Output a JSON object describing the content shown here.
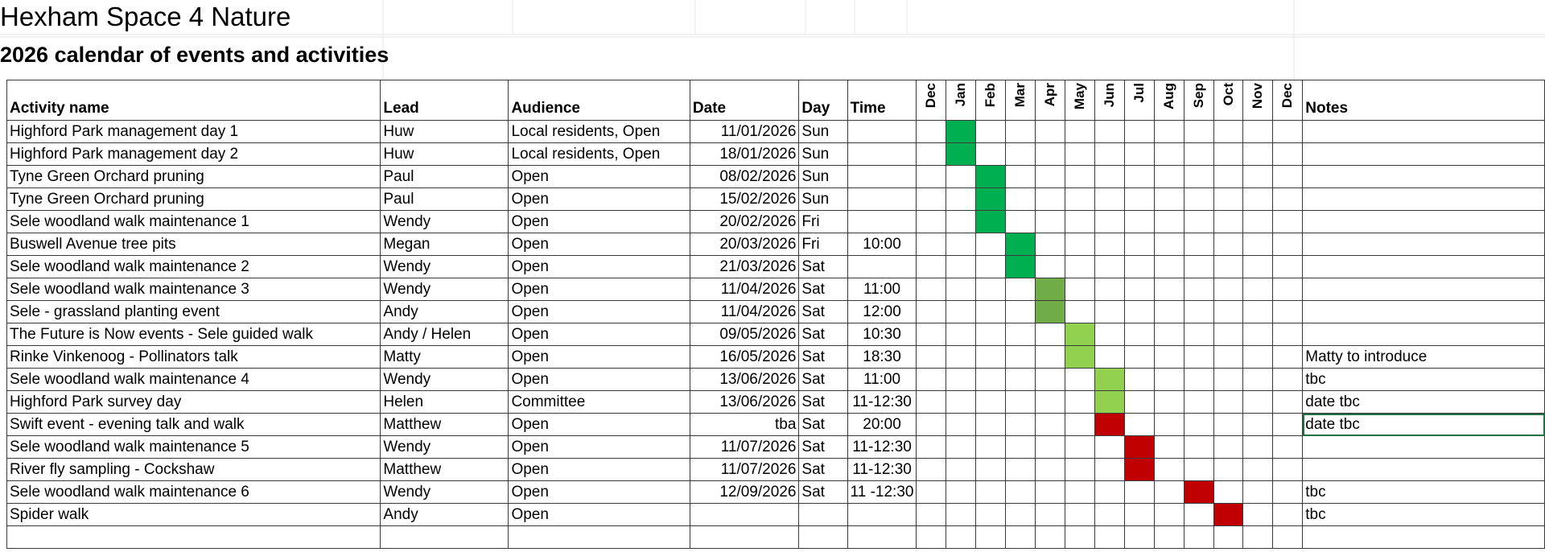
{
  "title": "Hexham Space 4 Nature",
  "subtitle": "2026 calendar of events and activities",
  "headers": {
    "activity": "Activity name",
    "lead": "Lead",
    "audience": "Audience",
    "date": "Date",
    "day": "Day",
    "time": "Time",
    "notes": "Notes",
    "months": [
      "Dec",
      "Jan",
      "Feb",
      "Mar",
      "Apr",
      "May",
      "Jun",
      "Jul",
      "Aug",
      "Sep",
      "Oct",
      "Nov",
      "Dec"
    ]
  },
  "colors": {
    "green_bright": "#00b050",
    "green_olive": "#70ad47",
    "green_light": "#92d050",
    "red": "#c00000"
  },
  "rows": [
    {
      "activity": "Highford Park management day 1",
      "lead": "Huw",
      "audience": "Local residents, Open",
      "date": "11/01/2026",
      "day": "Sun",
      "time": "",
      "notes": "",
      "month": 1,
      "color": "green_bright"
    },
    {
      "activity": "Highford Park management day 2",
      "lead": "Huw",
      "audience": "Local residents, Open",
      "date": "18/01/2026",
      "day": "Sun",
      "time": "",
      "notes": "",
      "month": 1,
      "color": "green_bright"
    },
    {
      "activity": "Tyne Green Orchard pruning",
      "lead": "Paul",
      "audience": "Open",
      "date": "08/02/2026",
      "day": "Sun",
      "time": "",
      "notes": "",
      "month": 2,
      "color": "green_bright"
    },
    {
      "activity": "Tyne Green Orchard pruning",
      "lead": "Paul",
      "audience": "Open",
      "date": "15/02/2026",
      "day": "Sun",
      "time": "",
      "notes": "",
      "month": 2,
      "color": "green_bright"
    },
    {
      "activity": "Sele woodland walk maintenance 1",
      "lead": "Wendy",
      "audience": "Open",
      "date": "20/02/2026",
      "day": "Fri",
      "time": "",
      "notes": "",
      "month": 2,
      "color": "green_bright"
    },
    {
      "activity": "Buswell Avenue tree pits",
      "lead": "Megan",
      "audience": "Open",
      "date": "20/03/2026",
      "day": "Fri",
      "time": "10:00",
      "notes": "",
      "month": 3,
      "color": "green_bright"
    },
    {
      "activity": "Sele woodland walk maintenance 2",
      "lead": "Wendy",
      "audience": "Open",
      "date": "21/03/2026",
      "day": "Sat",
      "time": "",
      "notes": "",
      "month": 3,
      "color": "green_bright"
    },
    {
      "activity": "Sele woodland walk maintenance 3",
      "lead": "Wendy",
      "audience": "Open",
      "date": "11/04/2026",
      "day": "Sat",
      "time": "11:00",
      "notes": "",
      "month": 4,
      "color": "green_olive"
    },
    {
      "activity": "Sele - grassland planting event",
      "lead": "Andy",
      "audience": "Open",
      "date": "11/04/2026",
      "day": "Sat",
      "time": "12:00",
      "notes": "",
      "month": 4,
      "color": "green_olive"
    },
    {
      "activity": "The Future is Now events - Sele guided walk",
      "lead": "Andy / Helen",
      "audience": "Open",
      "date": "09/05/2026",
      "day": "Sat",
      "time": "10:30",
      "notes": "",
      "month": 5,
      "color": "green_light"
    },
    {
      "activity": "Rinke Vinkenoog - Pollinators talk",
      "lead": "Matty",
      "audience": "Open",
      "date": "16/05/2026",
      "day": "Sat",
      "time": "18:30",
      "notes": "Matty to introduce",
      "month": 5,
      "color": "green_light"
    },
    {
      "activity": "Sele woodland walk maintenance 4",
      "lead": "Wendy",
      "audience": "Open",
      "date": "13/06/2026",
      "day": "Sat",
      "time": "11:00",
      "notes": "tbc",
      "month": 6,
      "color": "green_light"
    },
    {
      "activity": "Highford Park survey day",
      "lead": "Helen",
      "audience": "Committee",
      "date": "13/06/2026",
      "day": "Sat",
      "time": "11-12:30",
      "notes": "date tbc",
      "month": 6,
      "color": "green_light"
    },
    {
      "activity": "Swift event - evening talk and walk",
      "lead": "Matthew",
      "audience": "Open",
      "date": "tba",
      "day": "Sat",
      "time": "20:00",
      "notes": "date tbc",
      "month": 6,
      "color": "red"
    },
    {
      "activity": "Sele woodland walk maintenance 5",
      "lead": "Wendy",
      "audience": "Open",
      "date": "11/07/2026",
      "day": "Sat",
      "time": "11-12:30",
      "notes": "",
      "month": 7,
      "color": "red"
    },
    {
      "activity": "River fly sampling - Cockshaw",
      "lead": "Matthew",
      "audience": "Open",
      "date": "11/07/2026",
      "day": "Sat",
      "time": "11-12:30",
      "notes": "",
      "month": 7,
      "color": "red"
    },
    {
      "activity": "Sele woodland walk maintenance 6",
      "lead": "Wendy",
      "audience": "Open",
      "date": "12/09/2026",
      "day": "Sat",
      "time": "11 -12:30",
      "notes": "tbc",
      "month": 9,
      "color": "red"
    },
    {
      "activity": "Spider walk",
      "lead": "Andy",
      "audience": "Open",
      "date": "",
      "day": "",
      "time": "",
      "notes": "tbc",
      "month": 10,
      "color": "red"
    }
  ]
}
